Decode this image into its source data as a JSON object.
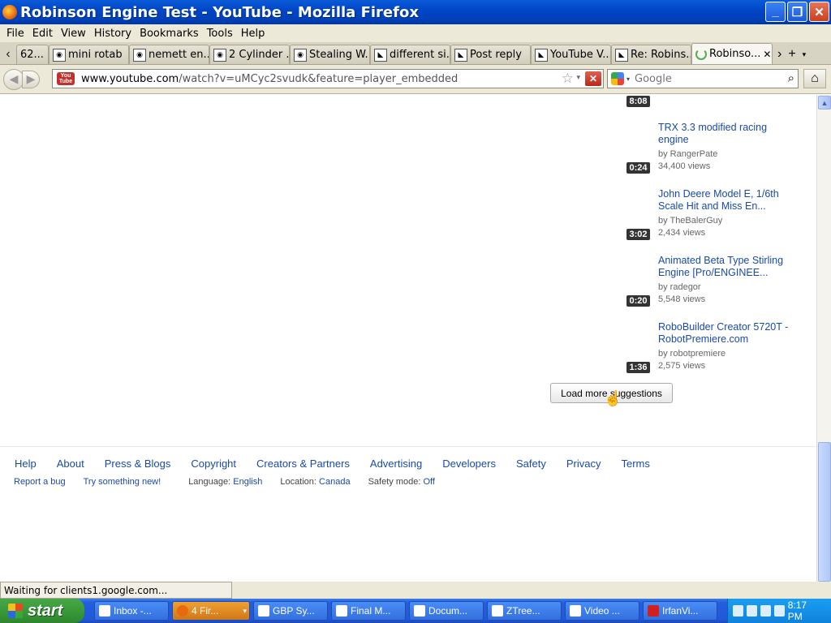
{
  "window": {
    "title": "Robinson Engine Test - YouTube - Mozilla Firefox"
  },
  "menu": [
    "File",
    "Edit",
    "View",
    "History",
    "Bookmarks",
    "Tools",
    "Help"
  ],
  "tabs": [
    {
      "label": "62..."
    },
    {
      "label": "mini rotab"
    },
    {
      "label": "nemett en..."
    },
    {
      "label": "2 Cylinder ..."
    },
    {
      "label": "Stealing W..."
    },
    {
      "label": "different si..."
    },
    {
      "label": "Post reply"
    },
    {
      "label": "YouTube V..."
    },
    {
      "label": "Re: Robins..."
    },
    {
      "label": "Robinso..."
    }
  ],
  "nav": {
    "url_host": "www.youtube.com",
    "url_path": "/watch?v=uMCyc2svudk&feature=player_embedded",
    "search_placeholder": "Google"
  },
  "suggestions": [
    {
      "duration": "8:08"
    },
    {
      "title": "TRX 3.3 modified racing engine",
      "by": "by RangerPate",
      "views": "34,400 views",
      "duration": "0:24"
    },
    {
      "title": "John Deere Model E, 1/6th Scale Hit and Miss En...",
      "by": "by TheBalerGuy",
      "views": "2,434 views",
      "duration": "3:02"
    },
    {
      "title": "Animated Beta Type Stirling Engine [Pro/ENGINEE...",
      "by": "by radegor",
      "views": "5,548 views",
      "duration": "0:20"
    },
    {
      "title": "RoboBuilder Creator 5720T - RobotPremiere.com",
      "by": "by robotpremiere",
      "views": "2,575 views",
      "duration": "1:36"
    }
  ],
  "load_more": "Load more suggestions",
  "footer": {
    "links": [
      "Help",
      "About",
      "Press & Blogs",
      "Copyright",
      "Creators & Partners",
      "Advertising",
      "Developers",
      "Safety",
      "Privacy",
      "Terms"
    ],
    "report_bug": "Report a bug",
    "try_new": "Try something new!",
    "language_label": "Language:",
    "language_value": "English",
    "location_label": "Location:",
    "location_value": "Canada",
    "safety_label": "Safety mode:",
    "safety_value": "Off"
  },
  "status": "Waiting for clients1.google.com...",
  "taskbar": {
    "start": "start",
    "items": [
      "Inbox -...",
      "4 Fir...",
      "GBP Sy...",
      "Final M...",
      "Docum...",
      "ZTree...",
      "Video ...",
      "IrfanVi..."
    ],
    "clock": "8:17 PM"
  }
}
